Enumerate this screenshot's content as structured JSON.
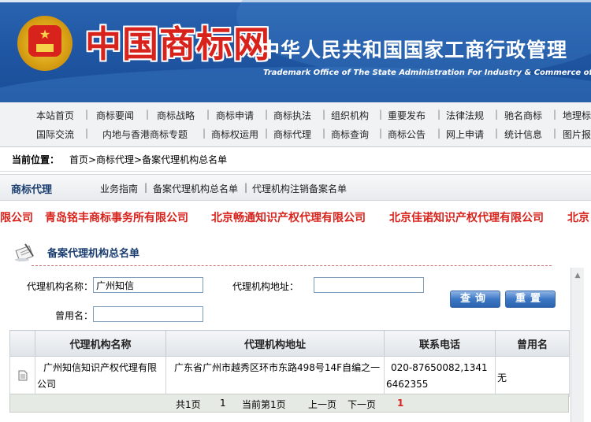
{
  "header": {
    "logo_text": "中国商标网",
    "org_name": "中华人民共和国国家工商行政管理",
    "org_name_en": "Trademark Office of The State Administration For Industry & Commerce of t",
    "emblem": "national-emblem",
    "colors": {
      "banner": "#1f56a3",
      "logo_red": "#d8231c"
    }
  },
  "nav": {
    "row1": [
      "本站首页",
      "商标要闻",
      "商标战略",
      "商标申请",
      "商标执法",
      "组织机构",
      "重要发布",
      "法律法规",
      "驰名商标",
      "地理标"
    ],
    "row2": [
      "国际交流",
      "内地与香港商标专题",
      "商标权运用",
      "商标代理",
      "商标查询",
      "商标公告",
      "网上申请",
      "统计信息",
      "图片报"
    ],
    "separator": "|"
  },
  "breadcrumb": {
    "label": "当前位置：",
    "path": "首页>商标代理>备案代理机构总名单"
  },
  "section": {
    "title": "商标代理",
    "links": [
      "业务指南",
      "备案代理机构总名单",
      "代理机构注销备案名单"
    ],
    "separator": "|"
  },
  "marquee": [
    "限公司",
    "青岛铭丰商标事务所有限公司",
    "北京畅通知识产权代理有限公司",
    "北京佳诺知识产权代理有限公司",
    "北京"
  ],
  "list": {
    "title": "备案代理机构总名单",
    "icon": "document-pen-icon"
  },
  "search": {
    "name_label": "代理机构名称：",
    "name_value": "广州知信",
    "address_label": "代理机构地址：",
    "address_value": "",
    "alias_label": "曾用名：",
    "alias_value": "",
    "query_button": "查询",
    "reset_button": "重置"
  },
  "table": {
    "headers": [
      "代理机构名称",
      "代理机构地址",
      "联系电话",
      "曾用名"
    ],
    "rows": [
      {
        "icon": "document-icon",
        "name": "广州知信知识产权代理有限公司",
        "address": "广东省广州市越秀区环市东路498号14F自编之一",
        "phone": "020-87650082,13416462355",
        "alias": "无"
      }
    ]
  },
  "pager": {
    "total": "共1页",
    "page_link": "1",
    "current": "当前第1页",
    "prev": "上一页",
    "next": "下一页",
    "current_page": "1"
  }
}
